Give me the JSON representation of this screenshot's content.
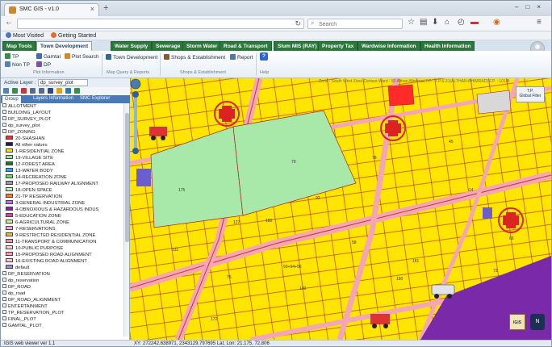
{
  "browser": {
    "tab_title": "SMC GIS - v1.0",
    "search_placeholder": "Search",
    "bookmarks": [
      "Most Visited",
      "Getting Started"
    ]
  },
  "ribbon": {
    "tabs": [
      "Map Tools",
      "Town Development",
      "Water Supply",
      "Sewerage",
      "Storm Water",
      "Road & Transport",
      "Slum MIS (RAY)",
      "Property Tax",
      "Wardwise Information",
      "Health Information"
    ],
    "active_tab": "Town Development",
    "buttons": {
      "tp": "TP",
      "gamtal": "Gamtal",
      "plot_search": "Plot Search",
      "non_tp": "Non TP",
      "dp": "DP",
      "town_development": "Town Development",
      "shops": "Shops & Establishment",
      "report": "Report",
      "help": "?"
    },
    "groups": [
      "Plot Information",
      "Map Query & Reports",
      "Shops & Establishment",
      "Help"
    ]
  },
  "layer_panel": {
    "active_layer_label": "Active Layer :",
    "active_layer_value": "dp_survey_plot",
    "tabs": [
      "Group",
      "Layers",
      "Information",
      "SMC Explorer"
    ],
    "items": [
      {
        "type": "text",
        "label": "ALLOTMENT"
      },
      {
        "type": "text",
        "label": "BUILDING_LAYOUT"
      },
      {
        "type": "text",
        "label": "DP_SURVEY_PLOT"
      },
      {
        "type": "text",
        "label": "dp_survey_plot"
      },
      {
        "type": "text",
        "label": "DP_ZONING"
      },
      {
        "type": "swatch",
        "color": "#ff2a2a",
        "label": "20-SHASHAN"
      },
      {
        "type": "swatch",
        "color": "#1b1f4a",
        "label": "All other values"
      },
      {
        "type": "swatch",
        "color": "#ffe600",
        "label": "1-RESIDENTIAL ZONE"
      },
      {
        "type": "swatch",
        "color": "#9be09b",
        "label": "19-VILLAGE SITE"
      },
      {
        "type": "swatch",
        "color": "#1f7a1f",
        "label": "12-FOREST AREA"
      },
      {
        "type": "swatch",
        "color": "#3aa0ff",
        "label": "13-WATER BODY"
      },
      {
        "type": "swatch",
        "color": "#6ed66e",
        "label": "14-RECREATION ZONE"
      },
      {
        "type": "swatch",
        "color": "#9a9a9a",
        "label": "17-PROPOSED RAILWAY ALIGNMENT"
      },
      {
        "type": "swatch",
        "color": "#b8f0b8",
        "label": "18-OPEN SPACE"
      },
      {
        "type": "swatch",
        "color": "#ff7a2a",
        "label": "21-TP RESERVATION"
      },
      {
        "type": "swatch",
        "color": "#b07adf",
        "label": "3-GENERAL INDUSTRIAL ZONE"
      },
      {
        "type": "swatch",
        "color": "#7a2aa8",
        "label": "4-OBNOXIOUS & HAZARDOUS INDUS"
      },
      {
        "type": "swatch",
        "color": "#e040a0",
        "label": "5-EDUCATION ZONE"
      },
      {
        "type": "swatch",
        "color": "#c8f08a",
        "label": "6-AGRICULTURAL ZONE"
      },
      {
        "type": "swatch",
        "color": "#f4a8c8",
        "label": "7-RESERVATIONS"
      },
      {
        "type": "swatch",
        "color": "#e6b84a",
        "label": "9-RESTRICTED RESIDENTIAL ZONE"
      },
      {
        "type": "swatch",
        "color": "#f28fa0",
        "label": "11-TRANSPORT & COMMUNICATION"
      },
      {
        "type": "swatch",
        "color": "#ffd0d0",
        "label": "10-PUBLIC PURPOSE"
      },
      {
        "type": "swatch",
        "color": "#ff9ab0",
        "label": "15-PROPOSED ROAD ALIGNMENT"
      },
      {
        "type": "swatch",
        "color": "#ffc6d2",
        "label": "16-EXISTING ROAD ALIGNMENT"
      },
      {
        "type": "swatch",
        "color": "#9a8ce0",
        "label": "default"
      },
      {
        "type": "text",
        "label": "DP_RESERVATION"
      },
      {
        "type": "text",
        "label": "dp_reservation"
      },
      {
        "type": "text",
        "label": "DP_ROAD"
      },
      {
        "type": "text",
        "label": "dp_road"
      },
      {
        "type": "text",
        "label": "DP_ROAD_ALIGNMENT"
      },
      {
        "type": "text",
        "label": "ENTERTAINMENT"
      },
      {
        "type": "text",
        "label": "TP_RESERVATION_PLOT"
      },
      {
        "type": "text",
        "label": "FINAL_PLOT"
      },
      {
        "type": "text",
        "label": "GAMTAL_PLOT"
      }
    ]
  },
  "map": {
    "breadcrumb": "Zone : South West Zone   Census Ward : 65 Althan-Bhimrad   T.P. : T.P.S.31(ALTHAN-BHIMRAD)   F.P. : 101/B",
    "global_filter": "T.P.\nGlobal Filter",
    "plot_labels": [
      "175",
      "70",
      "127",
      "180",
      "131",
      "92",
      "93+94+96",
      "130",
      "58",
      "172",
      "160",
      "161",
      "14",
      "66",
      "73",
      "78",
      "45",
      "75"
    ],
    "brand": "IGiS",
    "compass": "N"
  },
  "status": {
    "version": "IGiS web viewer ver 1.1",
    "coordinates": "XY: 272242.638971, 2343129.797695  Lat, Lon: 21.175, 72.806"
  }
}
